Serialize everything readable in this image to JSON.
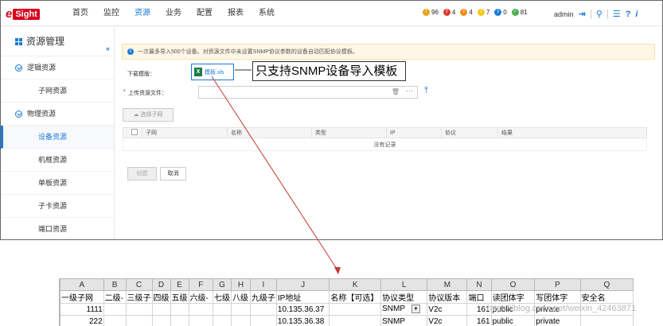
{
  "topbar": {
    "logo_e": "e",
    "logo_sight": "Sight",
    "nav": [
      "首页",
      "监控",
      "资源",
      "业务",
      "配置",
      "报表",
      "系统"
    ],
    "active_nav": "资源",
    "alarms": [
      {
        "icon": "critical-alarm-icon",
        "color": "#e8a317",
        "count": "96"
      },
      {
        "icon": "major-alarm-icon",
        "color": "#e23b2e",
        "count": "4"
      },
      {
        "icon": "minor-alarm-icon",
        "color": "#f08b1d",
        "count": "4"
      },
      {
        "icon": "warning-alarm-icon",
        "color": "#f2c811",
        "count": "7"
      },
      {
        "icon": "info-alarm-icon",
        "color": "#1a7ad6",
        "count": "0"
      },
      {
        "icon": "ok-status-icon",
        "color": "#4caf50",
        "count": "81"
      }
    ],
    "user": "admin"
  },
  "sidebar": {
    "title": "资源管理",
    "groups": [
      {
        "label": "逻辑资源",
        "items": [
          "子网资源"
        ]
      },
      {
        "label": "物理资源",
        "items": [
          "设备资源",
          "机框资源",
          "单板资源",
          "子卡资源",
          "端口资源"
        ]
      }
    ],
    "active_item": "设备资源"
  },
  "main": {
    "info_text": "一次最多导入500个设备。对资源文件中未设置SNMP协议参数的设备自动匹配协议模板。",
    "download_label": "下载模版：",
    "template_link": "模板.xls",
    "callout": "只支持SNMP设备导入模板",
    "upload_label": "上传资源文件：",
    "required_mark": "*",
    "select_subnet_btn": "选择子网",
    "table_headers": [
      "",
      "子网",
      "名称",
      "类型",
      "IP",
      "协议",
      "结果"
    ],
    "empty_text": "没有记录",
    "create_btn": "创建",
    "cancel_btn": "取消"
  },
  "sheet": {
    "col_letters": [
      "A",
      "B",
      "C",
      "D",
      "E",
      "F",
      "G",
      "H",
      "I",
      "J",
      "K",
      "L",
      "M",
      "N",
      "O",
      "P",
      "Q"
    ],
    "header_row": [
      "一级子网",
      "二级-",
      "三级子",
      "四级",
      "五级",
      "六级-",
      "七级",
      "八级",
      "九级子",
      "IP地址",
      "名称【可选】",
      "协议类型",
      "协议版本",
      "端口",
      "读团体字",
      "写团体字",
      "安全名"
    ],
    "rows": [
      [
        "1111",
        "",
        "",
        "",
        "",
        "",
        "",
        "",
        "",
        "10.135.36.37",
        "",
        "SNMP",
        "V2c",
        "161",
        "public",
        "private",
        ""
      ],
      [
        "222",
        "",
        "",
        "",
        "",
        "",
        "",
        "",
        "",
        "10.135.36.38",
        "",
        "SNMP",
        "V2c",
        "161",
        "public",
        "private",
        ""
      ]
    ],
    "watermark": "https://blog.csdn.net/weixin_42463871"
  },
  "colors": {
    "accent": "#1a7ad6",
    "brand": "#d8001c",
    "arrow": "#c0392b"
  }
}
